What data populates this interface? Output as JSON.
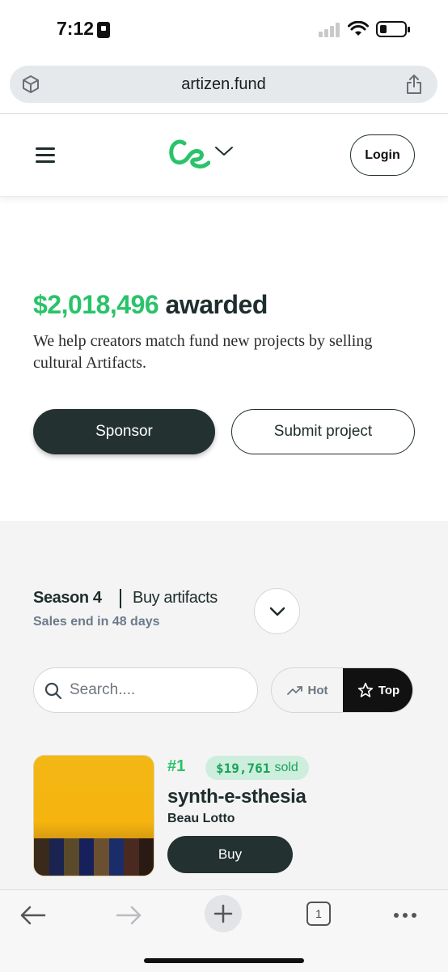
{
  "status_bar": {
    "time": "7:12"
  },
  "browser": {
    "url": "artizen.fund",
    "tab_count": "1"
  },
  "header": {
    "login_label": "Login"
  },
  "hero": {
    "amount": "$2,018,496",
    "amount_suffix": " awarded",
    "description": "We help creators match fund new projects by selling cultural Artifacts.",
    "sponsor_label": "Sponsor",
    "submit_label": "Submit project"
  },
  "season": {
    "label": "Season 4",
    "buy_label": "Buy artifacts",
    "sales_end": "Sales end in 48 days"
  },
  "search": {
    "placeholder": "Search...."
  },
  "sort": {
    "hot_label": "Hot",
    "top_label": "Top",
    "selected": "Top"
  },
  "artifacts": [
    {
      "rank": "#1",
      "sold_amount": "$19,761",
      "sold_suffix": "sold",
      "title": "synth-e-sthesia",
      "artist": "Beau Lotto",
      "buy_label": "Buy"
    }
  ],
  "colors": {
    "accent_green": "#29c36a",
    "dark_button": "#233131",
    "sold_badge_bg": "#cdeedd"
  },
  "icons": [
    "cube-icon",
    "share-icon",
    "menu-icon",
    "chevron-down-icon",
    "search-icon",
    "trending-icon",
    "star-icon",
    "back-arrow-icon",
    "forward-arrow-icon",
    "plus-icon",
    "tabs-icon",
    "more-icon"
  ]
}
